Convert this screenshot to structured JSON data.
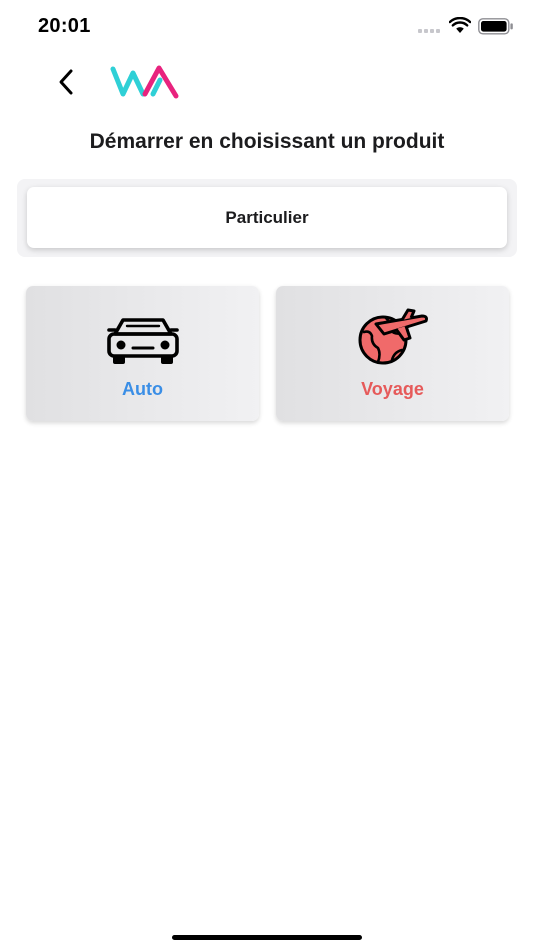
{
  "status_bar": {
    "time": "20:01"
  },
  "header": {
    "back_icon": "chevron-left-icon",
    "logo": "wa-logo"
  },
  "title": "Démarrer en choisissant un produit",
  "segment": {
    "selected_label": "Particulier"
  },
  "products": [
    {
      "label": "Auto",
      "icon": "car-icon",
      "color": "#3a8ee6"
    },
    {
      "label": "Voyage",
      "icon": "globe-plane-icon",
      "color": "#e65a5a"
    }
  ],
  "colors": {
    "brand_teal": "#2fd0d6",
    "brand_pink": "#e8237e",
    "auto_blue": "#3a8ee6",
    "voyage_red": "#e65a5a"
  }
}
